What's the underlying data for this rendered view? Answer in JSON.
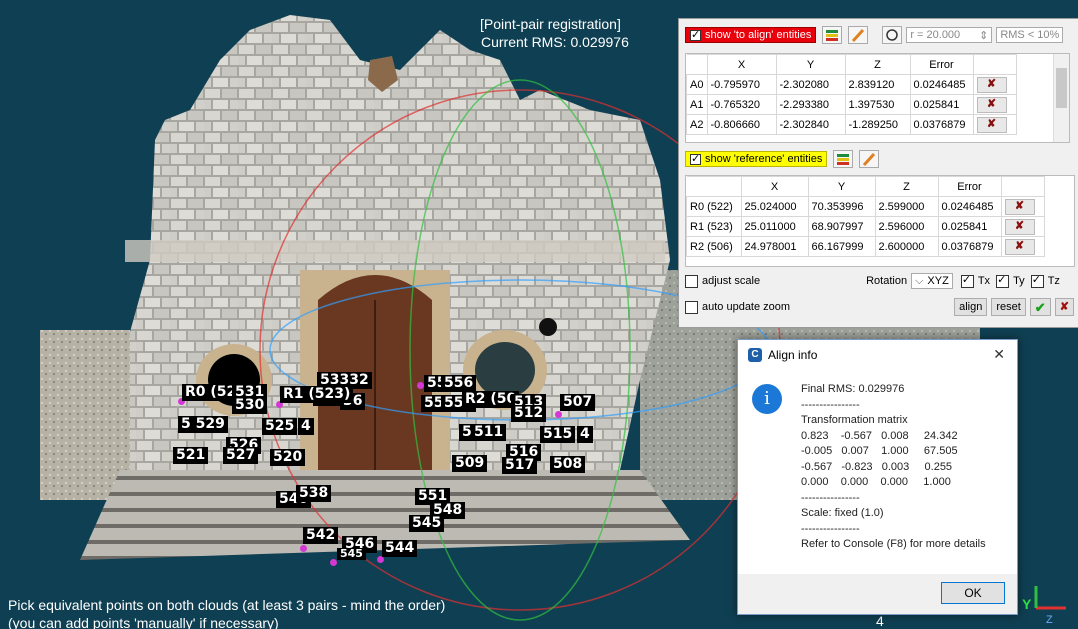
{
  "overlay": {
    "mode_title": "[Point-pair registration]",
    "current_rms": "Current RMS: 0.029976",
    "hint_line1": "Pick equivalent points on both clouds (at least 3 pairs - mind the order)",
    "hint_line2": "(you can add points 'manually' if necessary)",
    "scale_label": "4",
    "axis_y": "Y",
    "axis_z": "Z"
  },
  "markers": [
    "53332",
    "541",
    "36",
    "R0 (52",
    "531",
    "530",
    "R1 (523)",
    "55",
    "556",
    "55",
    "557",
    "R2 (50",
    "513",
    "512",
    "507",
    "5 529",
    "525",
    "4",
    "5",
    "511",
    "515",
    "4",
    "526",
    "521",
    "527",
    "520",
    "516",
    "509",
    "517",
    "508",
    "540",
    "538",
    "551",
    "548",
    "545",
    "542",
    "546",
    "545",
    "544"
  ],
  "align_panel": {
    "show_to_align_label": "show 'to align' entities",
    "radius": "r = 20.000",
    "rms_filter": "RMS < 10%",
    "columns": [
      "X",
      "Y",
      "Z",
      "Error"
    ],
    "rows": [
      {
        "id": "A0",
        "x": "-0.795970",
        "y": "-2.302080",
        "z": "2.839120",
        "err": "0.0246485"
      },
      {
        "id": "A1",
        "x": "-0.765320",
        "y": "-2.293380",
        "z": "1.397530",
        "err": "0.025841"
      },
      {
        "id": "A2",
        "x": "-0.806660",
        "y": "-2.302840",
        "z": "-1.289250",
        "err": "0.0376879"
      }
    ],
    "delete_glyph": "✘"
  },
  "reference_panel": {
    "show_reference_label": "show 'reference' entities",
    "columns": [
      "X",
      "Y",
      "Z",
      "Error"
    ],
    "rows": [
      {
        "id": "R0 (522)",
        "x": "25.024000",
        "y": "70.353996",
        "z": "2.599000",
        "err": "0.0246485"
      },
      {
        "id": "R1 (523)",
        "x": "25.011000",
        "y": "68.907997",
        "z": "2.596000",
        "err": "0.025841"
      },
      {
        "id": "R2 (506)",
        "x": "24.978001",
        "y": "66.167999",
        "z": "2.600000",
        "err": "0.0376879"
      }
    ]
  },
  "options": {
    "adjust_scale": "adjust scale",
    "auto_update_zoom": "auto update zoom",
    "rotation_label": "Rotation",
    "rotation_value": "XYZ",
    "tx": "Tx",
    "ty": "Ty",
    "tz": "Tz",
    "align_btn": "align",
    "reset_btn": "reset",
    "ok_glyph": "✔",
    "cancel_glyph": "✘"
  },
  "dialog": {
    "title": "Align info",
    "close_glyph": "✕",
    "message": "Final RMS: 0.029976\n----------------\nTransformation matrix\n0.823    -0.567   0.008     24.342\n-0.005   0.007    1.000     67.505\n-0.567   -0.823   0.003     0.255\n0.000    0.000    0.000     1.000\n----------------\nScale: fixed (1.0)\n----------------\nRefer to Console (F8) for more details",
    "ok_label": "OK"
  },
  "colors": {
    "viewport_bg": "#0f3f52",
    "red_highlight": "#e8000b",
    "yellow_highlight": "#ffff00",
    "point_marker": "#d438d4"
  }
}
